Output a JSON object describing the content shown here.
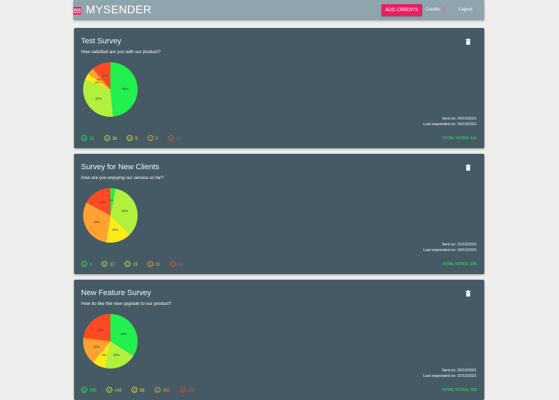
{
  "navbar": {
    "brand": "MYSENDER",
    "add_credits_label": "ADD CREDITS",
    "credits_label": "Credits:",
    "credits_count": "3",
    "logout_label": "Logout"
  },
  "colors": {
    "very_satisfied": "#22f04f",
    "satisfied": "#b2f03d",
    "neutral": "#ffeb1a",
    "dissatisfied": "#ffa231",
    "very_dissatisfied": "#ff4a23"
  },
  "icons": {
    "delete": "trash-icon",
    "faces": [
      "very-satisfied-face-icon",
      "satisfied-face-icon",
      "neutral-face-icon",
      "dissatisfied-face-icon",
      "very-dissatisfied-face-icon"
    ]
  },
  "surveys": [
    {
      "title": "Test Survey",
      "question": "How satisfied are you with our product?",
      "sent_on": "Sent on: 24/10/2021",
      "last_responded": "Last responded on: 24/10/2021",
      "total_votes": "TOTAL VOTES: 114",
      "counts": [
        "55",
        "36",
        "5",
        "5",
        "13"
      ],
      "chart_data": {
        "type": "pie",
        "categories": [
          "very satisfied",
          "satisfied",
          "neutral",
          "dissatisfied",
          "very dissatisfied"
        ],
        "values": [
          48,
          32,
          4,
          4,
          11
        ],
        "labels": [
          "48%",
          "32%",
          "4%",
          "4%",
          "11%"
        ]
      }
    },
    {
      "title": "Survey for New Clients",
      "question": "How are you enjoying our service so far?",
      "sent_on": "Sent on: 21/10/2021",
      "last_responded": "Last responded on: 24/10/2021",
      "total_votes": "TOTAL VOTES: 105",
      "counts": [
        "3",
        "37",
        "15",
        "30",
        "18"
      ],
      "chart_data": {
        "type": "pie",
        "categories": [
          "very satisfied",
          "satisfied",
          "neutral",
          "dissatisfied",
          "very dissatisfied"
        ],
        "values": [
          3,
          34,
          15,
          30,
          17
        ],
        "labels": [
          "3%",
          "34%",
          "15%",
          "30%",
          "17%"
        ]
      }
    },
    {
      "title": "New Feature Survey",
      "question": "How do like the new upgrade to our product?",
      "sent_on": "Sent on: 20/10/2021",
      "last_responded": "Last responded on: 22/10/2021",
      "total_votes": "TOTAL VOTES: 752",
      "counts": [
        "256",
        "143",
        "58",
        "150",
        "178"
      ],
      "chart_data": {
        "type": "pie",
        "categories": [
          "very satisfied",
          "satisfied",
          "neutral",
          "dissatisfied",
          "very dissatisfied"
        ],
        "values": [
          34,
          19,
          8,
          16,
          23
        ],
        "labels": [
          "34%",
          "19%",
          "8%",
          "16%",
          "23%"
        ]
      }
    }
  ]
}
